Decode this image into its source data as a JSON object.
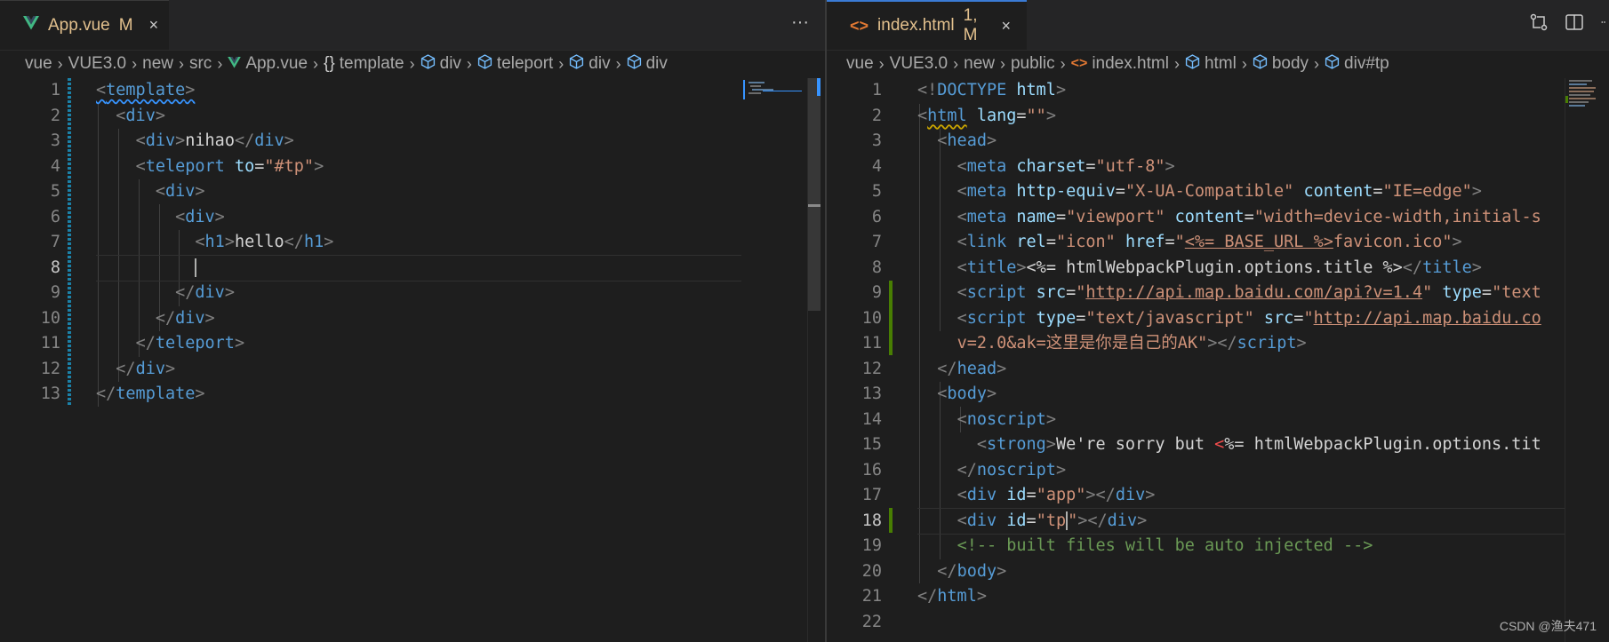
{
  "left": {
    "tab": {
      "icon": "vue-logo-icon",
      "name": "App.vue",
      "status": "M",
      "close": "×"
    },
    "more": "···",
    "breadcrumb": [
      {
        "text": "vue"
      },
      {
        "text": "VUE3.0"
      },
      {
        "text": "new"
      },
      {
        "text": "src"
      },
      {
        "text": "App.vue",
        "icon": "vue-logo-icon"
      },
      {
        "text": "template",
        "icon": "braces-icon"
      },
      {
        "text": "div",
        "icon": "cube-icon"
      },
      {
        "text": "teleport",
        "icon": "cube-icon"
      },
      {
        "text": "div",
        "icon": "cube-icon"
      },
      {
        "text": "div",
        "icon": "cube-icon"
      }
    ],
    "line_numbers": [
      "1",
      "2",
      "3",
      "4",
      "5",
      "6",
      "7",
      "8",
      "9",
      "10",
      "11",
      "12",
      "13"
    ],
    "active_line": "8",
    "code": {
      "l1": [
        "<",
        "template",
        ">"
      ],
      "l2": [
        "<",
        "div",
        ">"
      ],
      "l3": [
        "<",
        "div",
        ">",
        "nihao",
        "</",
        "div",
        ">"
      ],
      "l4": [
        "<",
        "teleport",
        " ",
        "to",
        "=",
        "\"#tp\"",
        ">"
      ],
      "l5": [
        "<",
        "div",
        ">"
      ],
      "l6": [
        "<",
        "div",
        ">"
      ],
      "l7": [
        "<",
        "h1",
        ">",
        "hello",
        "</",
        "h1",
        ">"
      ],
      "l9": [
        "</",
        "div",
        ">"
      ],
      "l10": [
        "</",
        "div",
        ">"
      ],
      "l11": [
        "</",
        "teleport",
        ">"
      ],
      "l12": [
        "</",
        "div",
        ">"
      ],
      "l13": [
        "</",
        "template",
        ">"
      ]
    }
  },
  "right": {
    "tab": {
      "icon": "html-code-icon",
      "name": "index.html",
      "status": "1, M",
      "close": "×"
    },
    "actions": [
      "compare-changes-icon",
      "split-editor-icon"
    ],
    "breadcrumb": [
      {
        "text": "vue"
      },
      {
        "text": "VUE3.0"
      },
      {
        "text": "new"
      },
      {
        "text": "public"
      },
      {
        "text": "index.html",
        "icon": "html-code-icon"
      },
      {
        "text": "html",
        "icon": "cube-icon"
      },
      {
        "text": "body",
        "icon": "cube-icon"
      },
      {
        "text": "div#tp",
        "icon": "cube-icon"
      }
    ],
    "line_numbers": [
      "1",
      "2",
      "3",
      "4",
      "5",
      "6",
      "7",
      "8",
      "9",
      "10",
      "11",
      "12",
      "13",
      "14",
      "15",
      "16",
      "17",
      "18",
      "19",
      "20",
      "21",
      "22"
    ],
    "active_line": "18",
    "code": {
      "l1": [
        "<!",
        "DOCTYPE",
        " ",
        "html",
        ">"
      ],
      "l2": [
        "<",
        "html",
        " ",
        "lang",
        "=",
        "\"\"",
        ">"
      ],
      "l3": [
        "<",
        "head",
        ">"
      ],
      "l4": [
        "<",
        "meta",
        " ",
        "charset",
        "=",
        "\"utf-8\"",
        ">"
      ],
      "l5": [
        "<",
        "meta",
        " ",
        "http-equiv",
        "=",
        "\"X-UA-Compatible\"",
        " ",
        "content",
        "=",
        "\"IE=edge\"",
        ">"
      ],
      "l6": [
        "<",
        "meta",
        " ",
        "name",
        "=",
        "\"viewport\"",
        " ",
        "content",
        "=",
        "\"width=device-width,initial-s"
      ],
      "l7": [
        "<",
        "link",
        " ",
        "rel",
        "=",
        "\"icon\"",
        " ",
        "href",
        "=",
        "\"",
        "<%= BASE_URL %>",
        "favicon.ico",
        "\"",
        ">"
      ],
      "l8": [
        "<",
        "title",
        ">",
        "<%= htmlWebpackPlugin.options.title %>",
        "</",
        "title",
        ">"
      ],
      "l9": [
        "<",
        "script",
        " ",
        "src",
        "=",
        "\"",
        "http://api.map.baidu.com/api?v=1.4",
        "\"",
        " ",
        "type",
        "=",
        "\"text"
      ],
      "l10": [
        "<",
        "script",
        " ",
        "type",
        "=",
        "\"text/javascript\"",
        " ",
        "src",
        "=",
        "\"",
        "http://api.map.baidu.co"
      ],
      "l11": [
        "v=2.0&ak=这里是你是自己的AK\"",
        "></",
        "script",
        ">"
      ],
      "l12": [
        "</",
        "head",
        ">"
      ],
      "l13": [
        "<",
        "body",
        ">"
      ],
      "l14": [
        "<",
        "noscript",
        ">"
      ],
      "l15": [
        "<",
        "strong",
        ">",
        "We're sorry but ",
        "<",
        "%= htmlWebpackPlugin.options.tit"
      ],
      "l16": [
        "</",
        "noscript",
        ">"
      ],
      "l17": [
        "<",
        "div",
        " ",
        "id",
        "=",
        "\"app\"",
        "></",
        "div",
        ">"
      ],
      "l18": [
        "<",
        "div",
        " ",
        "id",
        "=",
        "\"tp",
        "\"",
        "></",
        "div",
        ">"
      ],
      "l19": [
        "<!-- built files will be auto injected -->"
      ],
      "l20": [
        "</",
        "body",
        ">"
      ],
      "l21": [
        "</",
        "html",
        ">"
      ]
    }
  },
  "watermark": "CSDN @渔夫471"
}
